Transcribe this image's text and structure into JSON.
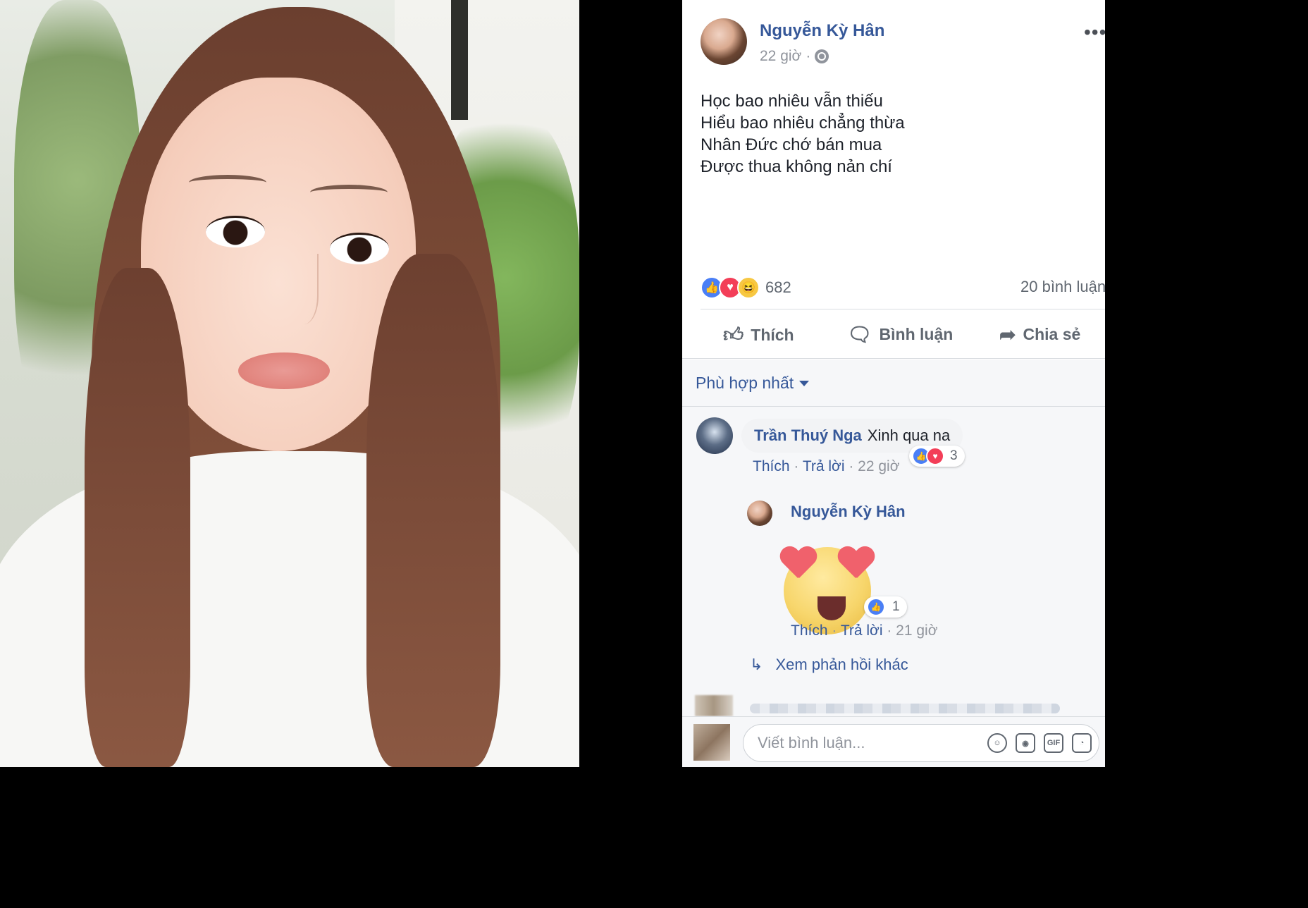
{
  "post": {
    "author": "Nguyễn Kỳ Hân",
    "time": "22 giờ",
    "privacy_icon": "globe-icon",
    "more_icon": "•••",
    "lines": [
      "Học bao nhiêu vẫn thiếu",
      "Hiểu bao nhiêu chẳng thừa",
      "Nhân Đức chớ bán mua",
      "Được thua không nản chí"
    ],
    "reaction_count": "682",
    "comment_count": "20 bình luận"
  },
  "actions": {
    "like": "Thích",
    "comment": "Bình luận",
    "share": "Chia sẻ"
  },
  "sort": {
    "label": "Phù hợp nhất"
  },
  "comments": [
    {
      "author": "Trần Thuý Nga",
      "text": "Xinh qua na",
      "like": "Thích",
      "reply": "Trả lời",
      "time": "22 giờ",
      "reaction_count": "3",
      "reply_item": {
        "author": "Nguyễn Kỳ Hân",
        "like": "Thích",
        "reply": "Trả lời",
        "time": "21 giờ",
        "reaction_count": "1"
      },
      "more_replies": "Xem phản hồi khác"
    }
  ],
  "composer": {
    "placeholder": "Viết bình luận...",
    "icons": [
      "emoji-icon",
      "camera-icon",
      "gif-icon",
      "sticker-icon"
    ],
    "gif_label": "GIF"
  },
  "colors": {
    "link": "#365899",
    "like_blue": "#4a7ff6",
    "love_red": "#f33e58"
  }
}
